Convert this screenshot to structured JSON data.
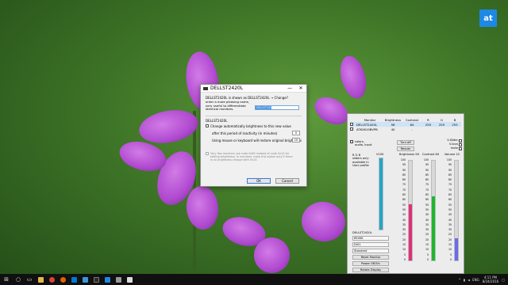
{
  "logo": {
    "text": "at"
  },
  "dialog": {
    "title": "DELLST2420L",
    "change_prefix": "DELLST2420L  is shown as",
    "change_name": "DELLST2420L",
    "change_link": "Change?",
    "description": "enter a more pleasing name, very useful to differentiate identical monitors.",
    "name_value": "DELLST2420L",
    "section_label": "DELLST2420L",
    "option_auto": "Change automatically brightness to this new value",
    "option_auto_value": "0",
    "option_period": "after this period of inactivity (in minutes)",
    "option_period_value": "10",
    "option_restore": "Using mouse or keyboard will restore original brightness",
    "disabled_note": "Very few monitors use code 0x60 instead of code 0x10 for setting brightness. In monitors, mark this option only if there is no brightness change with 0x10.",
    "ok_label": "OK",
    "cancel_label": "Cancel"
  },
  "panel": {
    "columns": [
      "Monitor",
      "Brightness",
      "Contrast",
      "R",
      "G",
      "B"
    ],
    "rows": [
      {
        "checked": true,
        "monitor": "DELLST2420L",
        "brightness": "56",
        "contrast": "64",
        "r": "255",
        "g": "255",
        "b": "255"
      },
      {
        "checked": true,
        "monitor": "ATK0615BVPB",
        "brightness": "40",
        "contrast": "-",
        "r": "",
        "g": "",
        "b": ""
      }
    ],
    "opt_colors": "colors, audio, input",
    "turn_off": "Turn off",
    "rescan": "Rescan",
    "v_slider": "V-Slider",
    "v_icon": "V-Icon",
    "mute": "mute",
    "rgb_note": "R G B sliders only available in User profile",
    "vol_label": "V100",
    "sliders": [
      {
        "label": "Brightness 56",
        "value": 56,
        "color": "#e0307a"
      },
      {
        "label": "Contrast 64",
        "value": 64,
        "color": "#1cb82e"
      },
      {
        "label": "Volume 22",
        "value": 22,
        "color": "#6b6bea"
      }
    ],
    "volume": {
      "value": 100,
      "color": "#22a7c9"
    },
    "ticks": [
      "100",
      "95",
      "90",
      "85",
      "80",
      "75",
      "70",
      "65",
      "60",
      "55",
      "50",
      "45",
      "40",
      "35",
      "30",
      "25",
      "20",
      "15",
      "10",
      "5",
      "0"
    ],
    "device_label": "DELLST2420L",
    "select_temp": "6500K",
    "select_input": "DVI1",
    "select_mode": "Standard",
    "reset_monitor": "Reset Monitor",
    "power": "Power Off/On",
    "rotate": "Rotate Display"
  },
  "taskbar": {
    "lang": "ENG",
    "time": "4:11 PM",
    "date": "8/24/2016"
  }
}
